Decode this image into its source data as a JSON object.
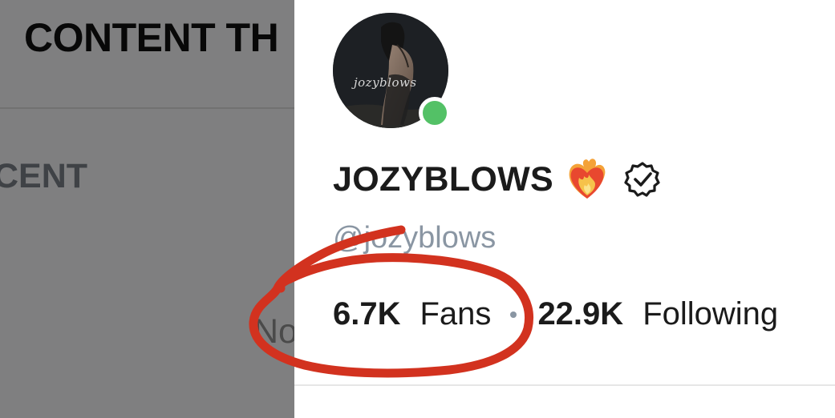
{
  "background_page": {
    "title": "CONTENT TH",
    "tab": "CENT",
    "fragment": "No"
  },
  "profile": {
    "avatar_watermark": "jozyblows",
    "online": true,
    "display_name": "JOZYBLOWS",
    "handle": "@jozyblows",
    "verified": true,
    "heart_icon": "heart-on-fire-icon",
    "fans_count": "6.7K",
    "fans_label": "Fans",
    "following_count": "22.9K",
    "following_label": "Following"
  },
  "colors": {
    "online_dot": "#53c166",
    "handle_text": "#8a96a3",
    "annotation": "#d2321f",
    "overlay": "rgba(0,0,0,0.48)"
  }
}
